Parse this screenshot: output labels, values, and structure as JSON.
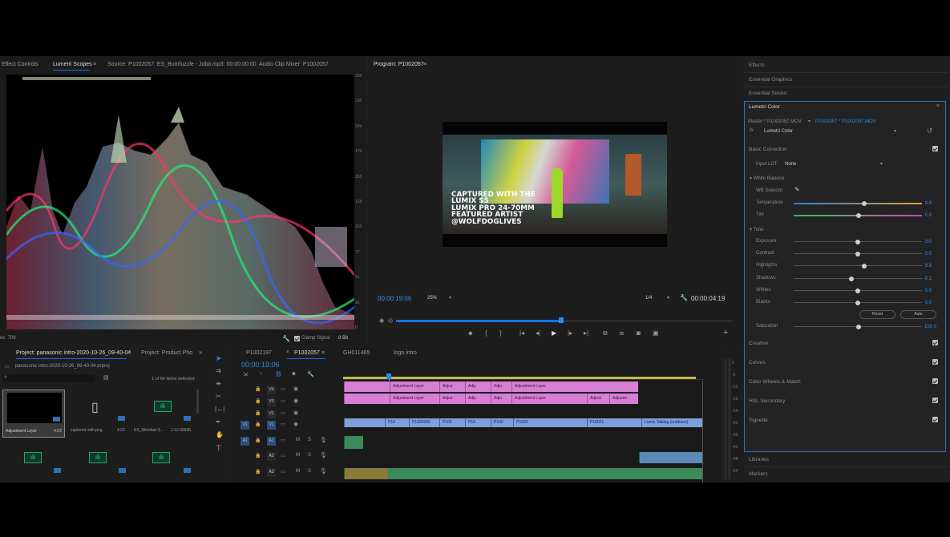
{
  "source_panel": {
    "tabs": [
      {
        "label": "Effect Controls"
      },
      {
        "label": "Lumetri Scopes"
      },
      {
        "label": "Source: P1002057: ES_Bumfuzzle - Joba.mp3: 00:00:00:00"
      },
      {
        "label": "Audio Clip Mixer: P1002057"
      }
    ],
    "scope_left_label": "ec. 709",
    "clamp_signal": "Clamp Signal",
    "bit_depth": "8 Bit",
    "scale": [
      "255",
      "230",
      "204",
      "179",
      "153",
      "128",
      "102",
      "77",
      "51",
      "26",
      "0"
    ]
  },
  "program": {
    "tab": "Program: P1002057",
    "overlay_lines": [
      "CAPTURED WITH THE",
      "LUMIX S5",
      "LUMIX PRO 24-70MM",
      "FEATURED ARTIST",
      "@WOLFDOGLIVES"
    ],
    "timecode": "00:00:19:06",
    "zoom": "25%",
    "resolution": "1/4",
    "duration": "00:00:04:19",
    "playhead_fraction": 0.49
  },
  "right_panel": {
    "sections": [
      "Effects",
      "Essential Graphics",
      "Essential Sound",
      "Lumetri Color"
    ],
    "master": "Master * P1002057.MOV",
    "clip": "P1002057 * P1002057.MOV",
    "effect": "Lumetri Color",
    "basic_correction": "Basic Correction",
    "input_lut_label": "Input LUT",
    "input_lut_value": "None",
    "white_balance": "White Balance",
    "wb_selector": "WB Selector",
    "temperature": {
      "label": "Temperature",
      "value": "9.8"
    },
    "tint": {
      "label": "Tint",
      "value": "0.0"
    },
    "tone": "Tone",
    "tone_rows": [
      {
        "label": "Exposure",
        "value": "0.0",
        "pos": 0.5
      },
      {
        "label": "Contrast",
        "value": "0.0",
        "pos": 0.5
      },
      {
        "label": "Highlights",
        "value": "9.8",
        "pos": 0.55
      },
      {
        "label": "Shadows",
        "value": "-9.1",
        "pos": 0.45
      },
      {
        "label": "Whites",
        "value": "0.0",
        "pos": 0.5
      },
      {
        "label": "Blacks",
        "value": "0.0",
        "pos": 0.5
      }
    ],
    "reset": "Reset",
    "auto": "Auto",
    "saturation": {
      "label": "Saturation",
      "value": "100.0"
    },
    "groups": [
      "Creative",
      "Curves",
      "Color Wheels & Match",
      "HSL Secondary",
      "Vignette"
    ],
    "bottom": [
      "Libraries",
      "Markers"
    ]
  },
  "project": {
    "tabs": [
      {
        "label": "Project: panasonic intro-2020-10-26_09-40-04"
      },
      {
        "label": "Project: Product Pho"
      }
    ],
    "file": "panasonic intro-2020-10-26_09-40-04.prproj",
    "selected": "1 of 64 items selected",
    "items": [
      {
        "name": "Adjustment Layer",
        "meta": "4:23"
      },
      {
        "name": "captured with.png",
        "meta": "4:23"
      },
      {
        "name": "ES_Wombat S...",
        "meta": "1:12:39936"
      }
    ]
  },
  "timeline": {
    "tabs": [
      {
        "label": "P1002197"
      },
      {
        "label": "P1002057"
      },
      {
        "label": "GH011465"
      },
      {
        "label": "logo intro"
      }
    ],
    "timecode": "00:00:19:06",
    "tracks": [
      "V4",
      "V3",
      "V2",
      "V1",
      "A1",
      "A2",
      "A3"
    ],
    "src_patch": [
      "V1",
      "A1"
    ],
    "v4_clips": [
      "Adjustment Layer",
      "Adjus",
      "Adju",
      "Adju",
      "Adjustment Layer"
    ],
    "v3_clips": [
      "Adjustment Layer",
      "Adjus",
      "Adju",
      "Adju",
      "Adjustment Layer",
      "Adjust",
      "Adjustm"
    ],
    "v1_clips": [
      "P10",
      "P1002055",
      "P100",
      "P10",
      "P100",
      "P1002",
      "P10021",
      "Lumix Talking (outdoors)"
    ],
    "meter_scale": [
      "0",
      "-6",
      "-12",
      "-18",
      "-24",
      "-30",
      "-36",
      "-42",
      "-48",
      "-54"
    ],
    "m": "M",
    "s": "S"
  },
  "colors": {
    "accent": "#1473e6",
    "timecode": "#2d8ceb",
    "adjustment_clip": "#d77fd6",
    "video_clip": "#7e9fdb",
    "audio_clip": "#3a8a5a"
  }
}
